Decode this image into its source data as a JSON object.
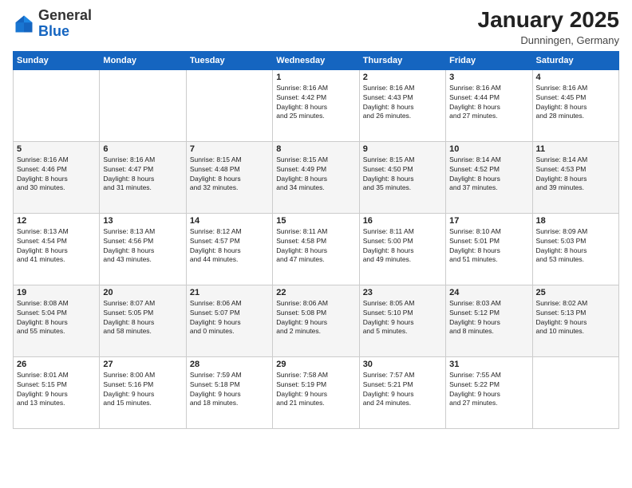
{
  "logo": {
    "general": "General",
    "blue": "Blue"
  },
  "title": "January 2025",
  "subtitle": "Dunningen, Germany",
  "days_of_week": [
    "Sunday",
    "Monday",
    "Tuesday",
    "Wednesday",
    "Thursday",
    "Friday",
    "Saturday"
  ],
  "weeks": [
    [
      {
        "day": "",
        "info": ""
      },
      {
        "day": "",
        "info": ""
      },
      {
        "day": "",
        "info": ""
      },
      {
        "day": "1",
        "info": "Sunrise: 8:16 AM\nSunset: 4:42 PM\nDaylight: 8 hours\nand 25 minutes."
      },
      {
        "day": "2",
        "info": "Sunrise: 8:16 AM\nSunset: 4:43 PM\nDaylight: 8 hours\nand 26 minutes."
      },
      {
        "day": "3",
        "info": "Sunrise: 8:16 AM\nSunset: 4:44 PM\nDaylight: 8 hours\nand 27 minutes."
      },
      {
        "day": "4",
        "info": "Sunrise: 8:16 AM\nSunset: 4:45 PM\nDaylight: 8 hours\nand 28 minutes."
      }
    ],
    [
      {
        "day": "5",
        "info": "Sunrise: 8:16 AM\nSunset: 4:46 PM\nDaylight: 8 hours\nand 30 minutes."
      },
      {
        "day": "6",
        "info": "Sunrise: 8:16 AM\nSunset: 4:47 PM\nDaylight: 8 hours\nand 31 minutes."
      },
      {
        "day": "7",
        "info": "Sunrise: 8:15 AM\nSunset: 4:48 PM\nDaylight: 8 hours\nand 32 minutes."
      },
      {
        "day": "8",
        "info": "Sunrise: 8:15 AM\nSunset: 4:49 PM\nDaylight: 8 hours\nand 34 minutes."
      },
      {
        "day": "9",
        "info": "Sunrise: 8:15 AM\nSunset: 4:50 PM\nDaylight: 8 hours\nand 35 minutes."
      },
      {
        "day": "10",
        "info": "Sunrise: 8:14 AM\nSunset: 4:52 PM\nDaylight: 8 hours\nand 37 minutes."
      },
      {
        "day": "11",
        "info": "Sunrise: 8:14 AM\nSunset: 4:53 PM\nDaylight: 8 hours\nand 39 minutes."
      }
    ],
    [
      {
        "day": "12",
        "info": "Sunrise: 8:13 AM\nSunset: 4:54 PM\nDaylight: 8 hours\nand 41 minutes."
      },
      {
        "day": "13",
        "info": "Sunrise: 8:13 AM\nSunset: 4:56 PM\nDaylight: 8 hours\nand 43 minutes."
      },
      {
        "day": "14",
        "info": "Sunrise: 8:12 AM\nSunset: 4:57 PM\nDaylight: 8 hours\nand 44 minutes."
      },
      {
        "day": "15",
        "info": "Sunrise: 8:11 AM\nSunset: 4:58 PM\nDaylight: 8 hours\nand 47 minutes."
      },
      {
        "day": "16",
        "info": "Sunrise: 8:11 AM\nSunset: 5:00 PM\nDaylight: 8 hours\nand 49 minutes."
      },
      {
        "day": "17",
        "info": "Sunrise: 8:10 AM\nSunset: 5:01 PM\nDaylight: 8 hours\nand 51 minutes."
      },
      {
        "day": "18",
        "info": "Sunrise: 8:09 AM\nSunset: 5:03 PM\nDaylight: 8 hours\nand 53 minutes."
      }
    ],
    [
      {
        "day": "19",
        "info": "Sunrise: 8:08 AM\nSunset: 5:04 PM\nDaylight: 8 hours\nand 55 minutes."
      },
      {
        "day": "20",
        "info": "Sunrise: 8:07 AM\nSunset: 5:05 PM\nDaylight: 8 hours\nand 58 minutes."
      },
      {
        "day": "21",
        "info": "Sunrise: 8:06 AM\nSunset: 5:07 PM\nDaylight: 9 hours\nand 0 minutes."
      },
      {
        "day": "22",
        "info": "Sunrise: 8:06 AM\nSunset: 5:08 PM\nDaylight: 9 hours\nand 2 minutes."
      },
      {
        "day": "23",
        "info": "Sunrise: 8:05 AM\nSunset: 5:10 PM\nDaylight: 9 hours\nand 5 minutes."
      },
      {
        "day": "24",
        "info": "Sunrise: 8:03 AM\nSunset: 5:12 PM\nDaylight: 9 hours\nand 8 minutes."
      },
      {
        "day": "25",
        "info": "Sunrise: 8:02 AM\nSunset: 5:13 PM\nDaylight: 9 hours\nand 10 minutes."
      }
    ],
    [
      {
        "day": "26",
        "info": "Sunrise: 8:01 AM\nSunset: 5:15 PM\nDaylight: 9 hours\nand 13 minutes."
      },
      {
        "day": "27",
        "info": "Sunrise: 8:00 AM\nSunset: 5:16 PM\nDaylight: 9 hours\nand 15 minutes."
      },
      {
        "day": "28",
        "info": "Sunrise: 7:59 AM\nSunset: 5:18 PM\nDaylight: 9 hours\nand 18 minutes."
      },
      {
        "day": "29",
        "info": "Sunrise: 7:58 AM\nSunset: 5:19 PM\nDaylight: 9 hours\nand 21 minutes."
      },
      {
        "day": "30",
        "info": "Sunrise: 7:57 AM\nSunset: 5:21 PM\nDaylight: 9 hours\nand 24 minutes."
      },
      {
        "day": "31",
        "info": "Sunrise: 7:55 AM\nSunset: 5:22 PM\nDaylight: 9 hours\nand 27 minutes."
      },
      {
        "day": "",
        "info": ""
      }
    ]
  ]
}
